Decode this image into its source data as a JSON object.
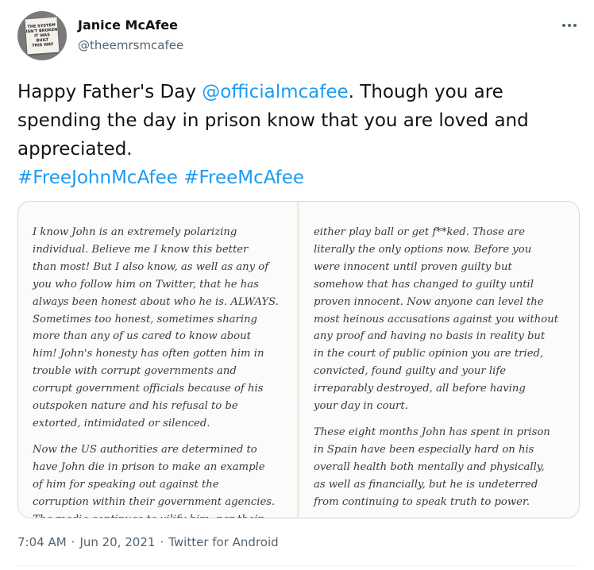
{
  "author": {
    "name": "Janice McAfee",
    "handle": "@theemrsmcafee",
    "avatar_text": [
      "THE SYSTEM",
      "ISN'T BROKEN",
      "IT WAS",
      "BUILT",
      "THIS WAY"
    ]
  },
  "tweet": {
    "text_intro": "Happy Father's Day ",
    "mention": "@officialmcafee",
    "text_body": ". Though you are spending the day in prison know that you are loved and appreciated.",
    "hashtags": [
      "#FreeJohnMcAfee",
      "#FreeMcAfee"
    ]
  },
  "letter": {
    "left_para1": [
      "I know John is an extremely polarizing",
      "individual. Believe me I know this better",
      "than most! But I also know, as well as any of",
      "you who follow him on Twitter, that he has",
      "always been honest about who he is. ALWAYS.",
      "Sometimes too honest, sometimes sharing",
      "more than any of us cared to know about",
      "him! John's honesty has often gotten him in",
      "trouble with corrupt governments and",
      "corrupt government officials because of his",
      "outspoken nature and his refusal to be",
      "extorted, intimidated or silenced."
    ],
    "left_para2": [
      "Now the US authorities are determined to",
      "have John die in prison to make an example",
      "of him for speaking out against the",
      "corruption within their government agencies.",
      "The media continues to vilify him, per their"
    ],
    "right_para1": [
      "either play ball or get f**ked. Those are",
      "literally the only options now. Before you",
      "were innocent until proven guilty but",
      "somehow that has changed to guilty until",
      "proven innocent. Now anyone can level the",
      "most heinous accusations against you without",
      "any proof and having no basis in reality but",
      "in the court of public opinion you are tried,",
      "convicted, found guilty and your life",
      "irreparably destroyed, all before having",
      "your day in court."
    ],
    "right_para2": [
      "These eight months John has spent in prison",
      "in Spain have been especially hard on his",
      "overall health both mentally and physically,",
      "as well as financially, but he is undeterred",
      "from continuing to speak truth to power."
    ]
  },
  "meta": {
    "time": "7:04 AM",
    "date": "Jun 20, 2021",
    "source": "Twitter for Android",
    "separator": "·"
  },
  "colors": {
    "link": "#1d9bf0",
    "secondary_text": "#536471",
    "primary_text": "#0f1419"
  }
}
